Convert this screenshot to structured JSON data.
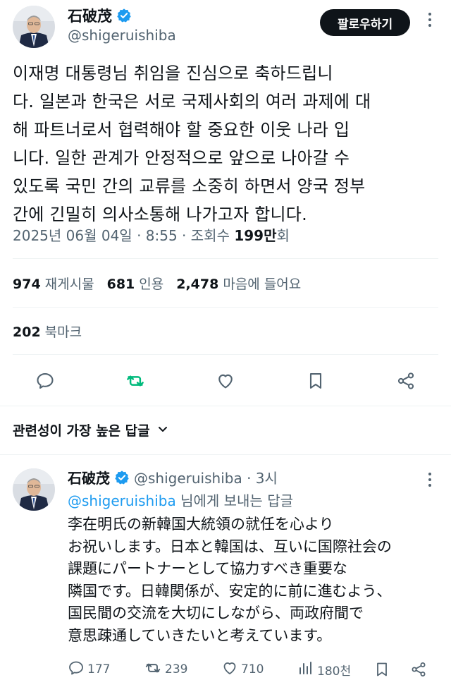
{
  "tweet": {
    "author_name": "石破茂",
    "author_handle": "@shigeruishiba",
    "follow_label": "팔로우하기",
    "text": "이재명 대통령님 취임을 진심으로 축하드립니\n다. 일본과 한국은 서로 국제사회의 여러 과제에 대\n해 파트너로서 협력해야 할 중요한 이웃 나라 입\n니다. 일한 관계가 안정적으로 앞으로 나아갈 수\n있도록 국민 간의 교류를 소중히 하면서 양국 정부\n간에 긴밀히 의사소통해 나가고자 합니다.",
    "date": "2025년 06월 04일 · 8:55 · 조회수 ",
    "views_number": "199만",
    "views_unit": "회",
    "reposts_count": "974",
    "reposts_label": "재게시물",
    "quotes_count": "681",
    "quotes_label": "인용",
    "likes_count": "2,478",
    "likes_label": "마음에 들어요",
    "bookmarks_count": "202",
    "bookmarks_label": "북마크"
  },
  "replies_sort": {
    "label": "관련성이 가장 높은 답글"
  },
  "reply": {
    "author_name": "石破茂",
    "author_handle": "@shigeruishiba · 3시",
    "replying_to_handle": "@shigeruishiba",
    "replying_to_suffix": " 님에게 보내는 답글",
    "text": "李在明氏の新韓国大統領の就任を心より\nお祝いします。日本と韓国は、互いに国際社会の\n課題にパートナーとして協力すべき重要な\n隣国です。日韓関係が、安定的に前に進むよう、\n国民間の交流を大切にしながら、両政府間で\n意思疎通していきたいと考えています。",
    "replies": "177",
    "reposts": "239",
    "likes": "710",
    "views": "180천"
  },
  "colors": {
    "text": "#0f1419",
    "secondary": "#536471",
    "accent_blue": "#1d9bf0",
    "repost_green": "#00ba7c",
    "divider": "#eff3f4"
  },
  "icons": [
    "verified-badge-icon",
    "more-icon",
    "reply-icon",
    "repost-icon",
    "like-icon",
    "bookmark-icon",
    "share-icon",
    "views-icon",
    "chevron-down-icon"
  ]
}
